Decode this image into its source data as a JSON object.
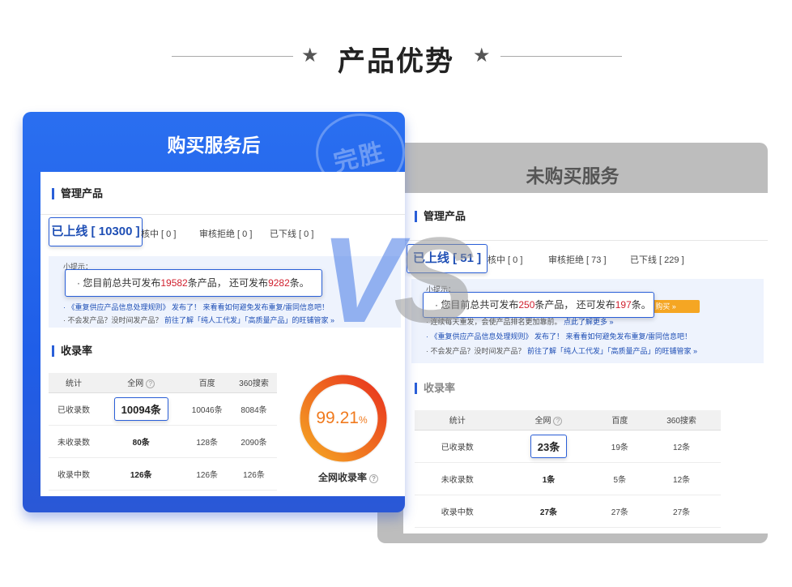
{
  "heading": {
    "title": "产品优势",
    "star": "★"
  },
  "vs_text": {
    "v": "V",
    "s": "S"
  },
  "after": {
    "card_title": "购买服务后",
    "stamp": "完胜",
    "section_manage": "管理产品",
    "tabs": {
      "online": "已上线 [ 10300 ]",
      "reviewing": "审核中 [ 0 ]",
      "reviewing_partial": "核中 [ 0 ]",
      "rejected": "审核拒绝 [ 0 ]",
      "offline": "已下线 [ 0 ]"
    },
    "tips_title": "小提示：",
    "notice": {
      "prefix": "· 您目前总共可发布",
      "total": "19582",
      "mid": "条产品， 还可发布",
      "remain": "9282",
      "suffix": "条。"
    },
    "tip_lines": [
      {
        "pre": "· 《重复供应产品信息处理规则》 发布了！ 来看看如何避免发布重复/雷同信息吧！",
        "link": ""
      },
      {
        "pre": "· 不会发产品？没时间发产品？ ",
        "link": "前往了解「纯人工代发」「高质量产品」的旺铺管家 »"
      }
    ],
    "section_index": "收录率",
    "table": {
      "headers": [
        "统计",
        "全网",
        "百度",
        "360搜索"
      ],
      "rows": [
        [
          "已收录数",
          "10094条",
          "10046条",
          "8084条"
        ],
        [
          "未收录数",
          "80条",
          "128条",
          "2090条"
        ],
        [
          "收录中数",
          "126条",
          "126条",
          "126条"
        ]
      ]
    },
    "gauge": {
      "value": 99.21,
      "display": "99.21",
      "unit": "%",
      "label": "全网收录率",
      "color_start": "#f5a623",
      "color_end": "#e8321e"
    }
  },
  "before": {
    "card_title": "未购买服务",
    "section_manage": "管理产品",
    "tabs": {
      "online": "已上线 [ 51 ]",
      "reviewing_partial": "核中 [ 0 ]",
      "rejected": "审核拒绝 [ 73 ]",
      "offline": "已下线 [ 229 ]"
    },
    "tips_title": "小提示：",
    "notice": {
      "prefix": "· 您目前总共可发布",
      "total": "250",
      "mid": "条产品， 还可发布",
      "remain": "197",
      "suffix": "条。"
    },
    "buy_button": "立即购买 »",
    "buy_button_visible": "购买 »",
    "tip_lines": [
      {
        "pre": "· 连续每天重发，会使产品排名更加靠前。 ",
        "link": "点此了解更多 »"
      },
      {
        "pre": "· 《重复供应产品信息处理规则》 发布了！ 来看看如何避免发布重复/雷同信息吧！",
        "link": ""
      },
      {
        "pre": "· 不会发产品？没时间发产品？ ",
        "link": "前往了解「纯人工代发」「高质量产品」的旺铺管家 »"
      }
    ],
    "section_index": "收录率",
    "table": {
      "headers": [
        "统计",
        "全网",
        "百度",
        "360搜索"
      ],
      "rows": [
        [
          "已收录数",
          "23条",
          "19条",
          "12条"
        ],
        [
          "未收录数",
          "1条",
          "5条",
          "12条"
        ],
        [
          "收录中数",
          "27条",
          "27条",
          "27条"
        ]
      ]
    }
  }
}
